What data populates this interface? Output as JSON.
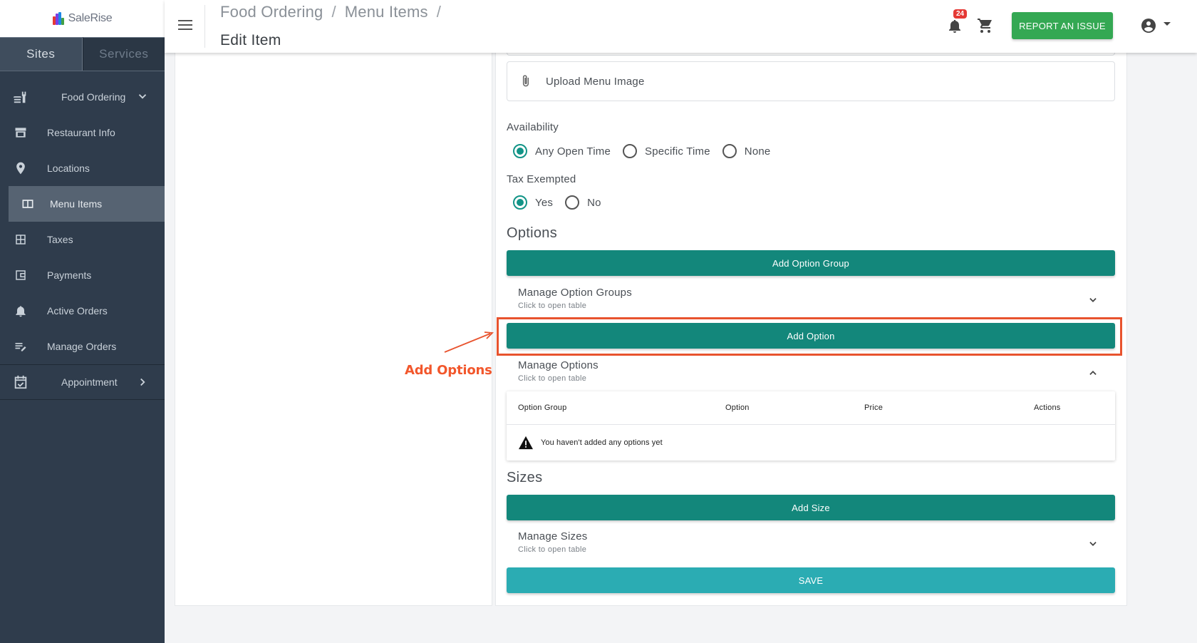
{
  "app": {
    "logo_text": "SaleRise",
    "accent_color": "#13877b",
    "save_color": "#2bacb3",
    "report_color": "#34a853",
    "annotation_color": "#f2572c"
  },
  "sidebar": {
    "tabs": [
      {
        "label": "Sites",
        "active": true
      },
      {
        "label": "Services",
        "active": false
      }
    ],
    "group": {
      "label": "Food Ordering",
      "icon": "food-icon"
    },
    "items": [
      {
        "label": "Restaurant Info",
        "icon": "storefront-icon"
      },
      {
        "label": "Locations",
        "icon": "location-pin-icon"
      },
      {
        "label": "Menu Items",
        "icon": "menu-book-icon",
        "active": true
      },
      {
        "label": "Taxes",
        "icon": "calculator-icon"
      },
      {
        "label": "Payments",
        "icon": "wallet-icon"
      },
      {
        "label": "Active Orders",
        "icon": "bell-ring-icon"
      },
      {
        "label": "Manage Orders",
        "icon": "edit-list-icon"
      }
    ],
    "appointment": {
      "label": "Appointment",
      "icon": "calendar-check-icon"
    }
  },
  "header": {
    "breadcrumb": [
      "Food Ordering",
      "Menu Items"
    ],
    "separator": "/",
    "page_title": "Edit Item",
    "notification_count": "24",
    "report_label": "REPORT AN ISSUE"
  },
  "form": {
    "upload_label": "Upload Menu Image",
    "availability": {
      "label": "Availability",
      "options": [
        "Any Open Time",
        "Specific Time",
        "None"
      ],
      "selected": "Any Open Time"
    },
    "tax_exempted": {
      "label": "Tax Exempted",
      "options": [
        "Yes",
        "No"
      ],
      "selected": "Yes"
    },
    "options_section": {
      "heading": "Options",
      "add_group_label": "Add Option Group",
      "manage_groups": {
        "title": "Manage Option Groups",
        "subtitle": "Click to open table"
      },
      "add_option_label": "Add Option",
      "manage_options": {
        "title": "Manage Options",
        "subtitle": "Click to open table"
      },
      "table": {
        "columns": [
          "Option Group",
          "Option",
          "Price",
          "Actions"
        ],
        "empty_message": "You haven't added any options yet"
      }
    },
    "sizes_section": {
      "heading": "Sizes",
      "add_size_label": "Add Size",
      "manage_sizes": {
        "title": "Manage Sizes",
        "subtitle": "Click to open table"
      }
    },
    "save_label": "SAVE"
  },
  "annotation": {
    "text": "Add Options"
  }
}
